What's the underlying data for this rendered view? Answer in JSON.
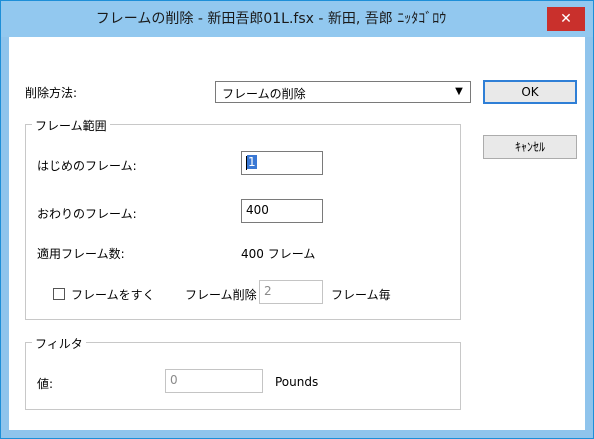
{
  "window": {
    "title": "フレームの削除 - 新田吾郎01L.fsx - 新田, 吾郎 ﾆｯﾀｺﾞﾛｳ",
    "close_glyph": "✕"
  },
  "method": {
    "label": "削除方法:",
    "selected": "フレームの削除",
    "arrow_glyph": "▼"
  },
  "buttons": {
    "ok": "OK",
    "cancel": "ｷｬﾝｾﾙ"
  },
  "frame_range": {
    "legend": "フレーム範囲",
    "start_label": "はじめのフレーム:",
    "start_value": "1",
    "end_label": "おわりのフレーム:",
    "end_value": "400",
    "count_label": "適用フレーム数:",
    "count_value": "400 フレーム",
    "skip_label": "フレームをすく",
    "skip_checked": false,
    "delete_label": "フレーム削除",
    "delete_value": "2",
    "per_label": "フレーム毎"
  },
  "filter": {
    "legend": "フィルタ",
    "value_label": "値:",
    "value": "0",
    "unit": "Pounds"
  },
  "colors": {
    "titlebar": "#92c8ef",
    "close": "#c9302c",
    "accent": "#2f7fd6"
  }
}
